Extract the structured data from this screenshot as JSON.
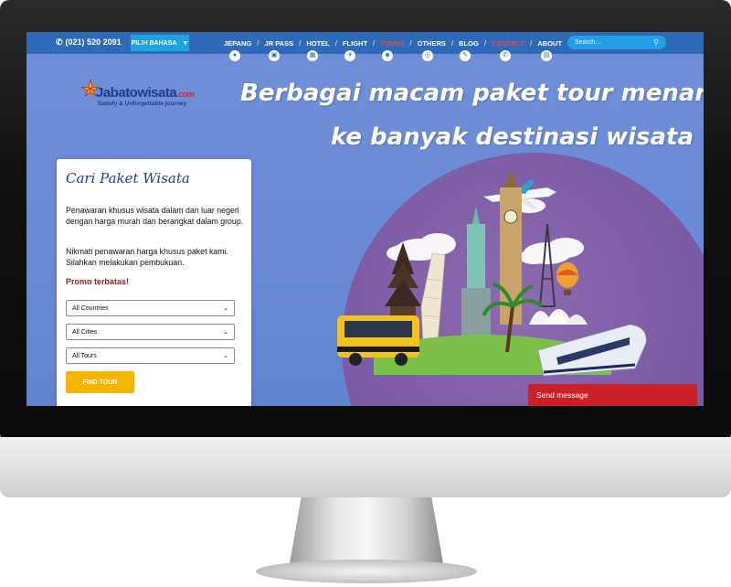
{
  "nav": {
    "phone": "(021) 520 2091",
    "language_label": "PILIH BAHASA",
    "items": [
      {
        "label": "JEPANG",
        "icon": "circle-icon"
      },
      {
        "label": "JR PASS",
        "icon": "train-icon"
      },
      {
        "label": "HOTEL",
        "icon": "building-icon"
      },
      {
        "label": "FLIGHT",
        "icon": "plane-icon"
      },
      {
        "label": "TOURS",
        "icon": "people-icon",
        "active": true
      },
      {
        "label": "OTHERS",
        "icon": "globe-icon"
      },
      {
        "label": "BLOG",
        "icon": "pen-icon"
      },
      {
        "label": "CONTACT",
        "icon": "phone-icon",
        "active": true
      },
      {
        "label": "ABOUT",
        "icon": "briefcase-icon"
      }
    ],
    "search_placeholder": "Search...",
    "active_color": "#e64b4b",
    "bar_color": "#2f6ab8"
  },
  "logo": {
    "brand": "Jabatowisata",
    "suffix": ".com",
    "tagline": "Satisfy & Unforgettable journey"
  },
  "hero": {
    "headline_line1": "Berbagai macam paket tour menarik",
    "headline_line2": "ke banyak destinasi wisata"
  },
  "search_card": {
    "title": "Cari Paket Wisata",
    "para1": "Penawaran khusus wisata dalam dan luar negeri dengan harga murah dan berangkat dalam group.",
    "para2": "Nikmati penawaran harga khusus paket kami. Silahkan melakukan pembukuan.",
    "promo": "Promo terbatas!",
    "country_select": "All Countries",
    "city_select": "All Cities",
    "tour_select": "All Tours",
    "button": "FIND TOUR"
  },
  "send_message": "Send message",
  "colors": {
    "accent_button": "#f4b400",
    "send_message_bg": "#cc2027",
    "search_bg": "#23a0e4"
  }
}
